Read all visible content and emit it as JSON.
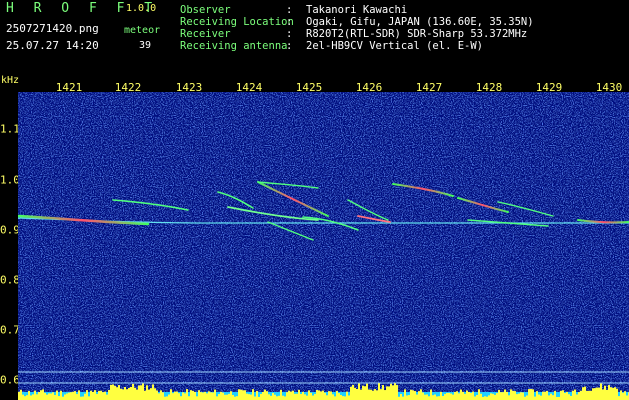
{
  "header": {
    "app_title": "H R O F F T",
    "app_version": "1.0.0",
    "file_name": "2507271420.png",
    "datetime": "25.07.27 14:20",
    "meteor_label": "meteor",
    "meteor_count": "39"
  },
  "meta": [
    {
      "label": "Observer",
      "colon": ":",
      "value": "Takanori Kawachi"
    },
    {
      "label": "Receiving Location",
      "colon": ":",
      "value": "Ogaki, Gifu, JAPAN (136.60E, 35.35N)"
    },
    {
      "label": "Receiver",
      "colon": ":",
      "value": "R820T2(RTL-SDR) SDR-Sharp 53.372MHz"
    },
    {
      "label": "Receiving antenna",
      "colon": ":",
      "value": "2el-HB9CV Vertical (el. E-W)"
    }
  ],
  "axis": {
    "y_unit": "kHz",
    "y_ticks": [
      "1.1",
      "1.0",
      "0.9",
      "0.8",
      "0.7",
      "0.6"
    ],
    "x_ticks": [
      "1421",
      "1422",
      "1423",
      "1424",
      "1425",
      "1426",
      "1427",
      "1428",
      "1429",
      "1430"
    ]
  },
  "colors": {
    "header_label": "#7cff7c",
    "header_value": "#ffffff",
    "axis": "#ffff66",
    "background": "#000080"
  }
}
